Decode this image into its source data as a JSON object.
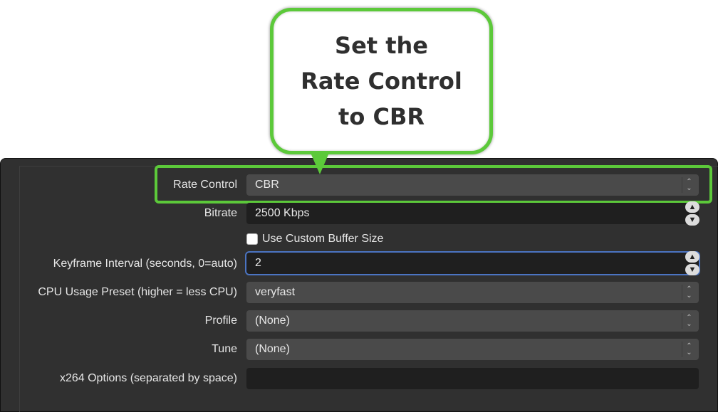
{
  "callout": {
    "lines": [
      "Set the",
      "Rate Control",
      "to CBR"
    ]
  },
  "settings": {
    "rate_control": {
      "label": "Rate Control",
      "value": "CBR"
    },
    "bitrate": {
      "label": "Bitrate",
      "value": "2500 Kbps"
    },
    "custom_buffer": {
      "label": "Use Custom Buffer Size",
      "checked": false
    },
    "keyframe": {
      "label": "Keyframe Interval (seconds, 0=auto)",
      "value": "2"
    },
    "cpu_preset": {
      "label": "CPU Usage Preset (higher = less CPU)",
      "value": "veryfast"
    },
    "profile": {
      "label": "Profile",
      "value": "(None)"
    },
    "tune": {
      "label": "Tune",
      "value": "(None)"
    },
    "x264_options": {
      "label": "x264 Options (separated by space)",
      "value": ""
    }
  },
  "colors": {
    "highlight": "#5cc93a",
    "panel_bg": "#303030",
    "select_bg": "#4a4a4a",
    "input_bg": "#1f1f1f",
    "focus_ring": "#4b74c2"
  },
  "icons": {
    "select_arrows": "updown-chevron-icon",
    "stepper_up": "stepper-up-icon",
    "stepper_down": "stepper-down-icon"
  }
}
